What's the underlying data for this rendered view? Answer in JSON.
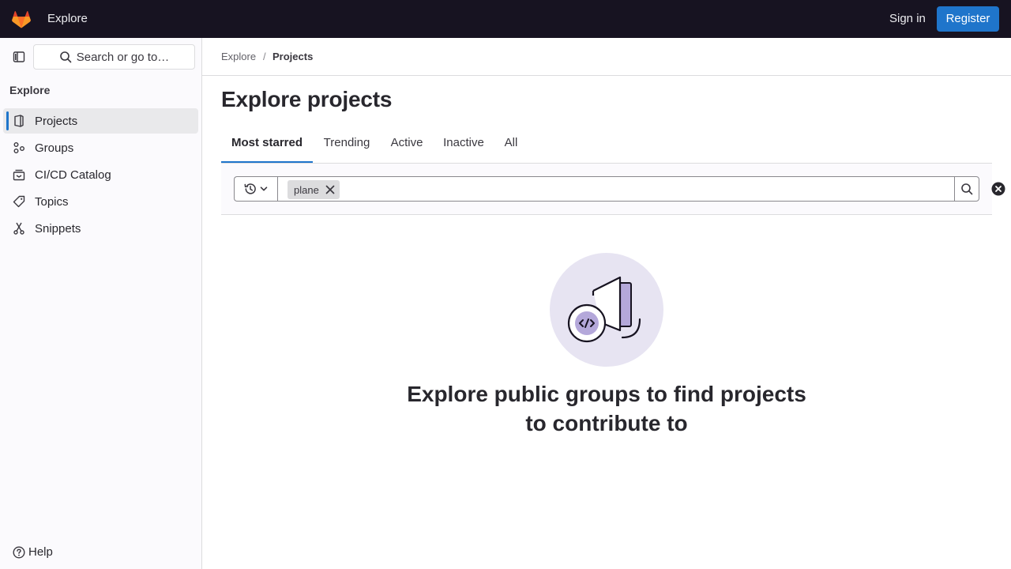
{
  "topbar": {
    "title": "Explore",
    "sign_in": "Sign in",
    "register": "Register",
    "logo_icon": "gitlab-tanuki-icon"
  },
  "sidebar": {
    "search_label": "Search or go to…",
    "heading": "Explore",
    "items": [
      {
        "label": "Projects",
        "icon": "project-icon",
        "active": true
      },
      {
        "label": "Groups",
        "icon": "group-icon",
        "active": false
      },
      {
        "label": "CI/CD Catalog",
        "icon": "catalog-icon",
        "active": false
      },
      {
        "label": "Topics",
        "icon": "label-icon",
        "active": false
      },
      {
        "label": "Snippets",
        "icon": "snippet-icon",
        "active": false
      }
    ],
    "help": "Help"
  },
  "breadcrumb": {
    "items": [
      "Explore",
      "Projects"
    ],
    "separator": "/"
  },
  "main": {
    "title": "Explore projects",
    "tabs": [
      "Most starred",
      "Trending",
      "Active",
      "Inactive",
      "All"
    ],
    "active_tab": "Most starred",
    "filter": {
      "token": "plane"
    },
    "empty_state": {
      "title": "Explore public groups to find projects to contribute to"
    }
  },
  "colors": {
    "topbar_bg": "#171321",
    "accent": "#1f75cb",
    "sidebar_bg": "#fbfafd",
    "illustration_bg": "#e7e4f2"
  }
}
